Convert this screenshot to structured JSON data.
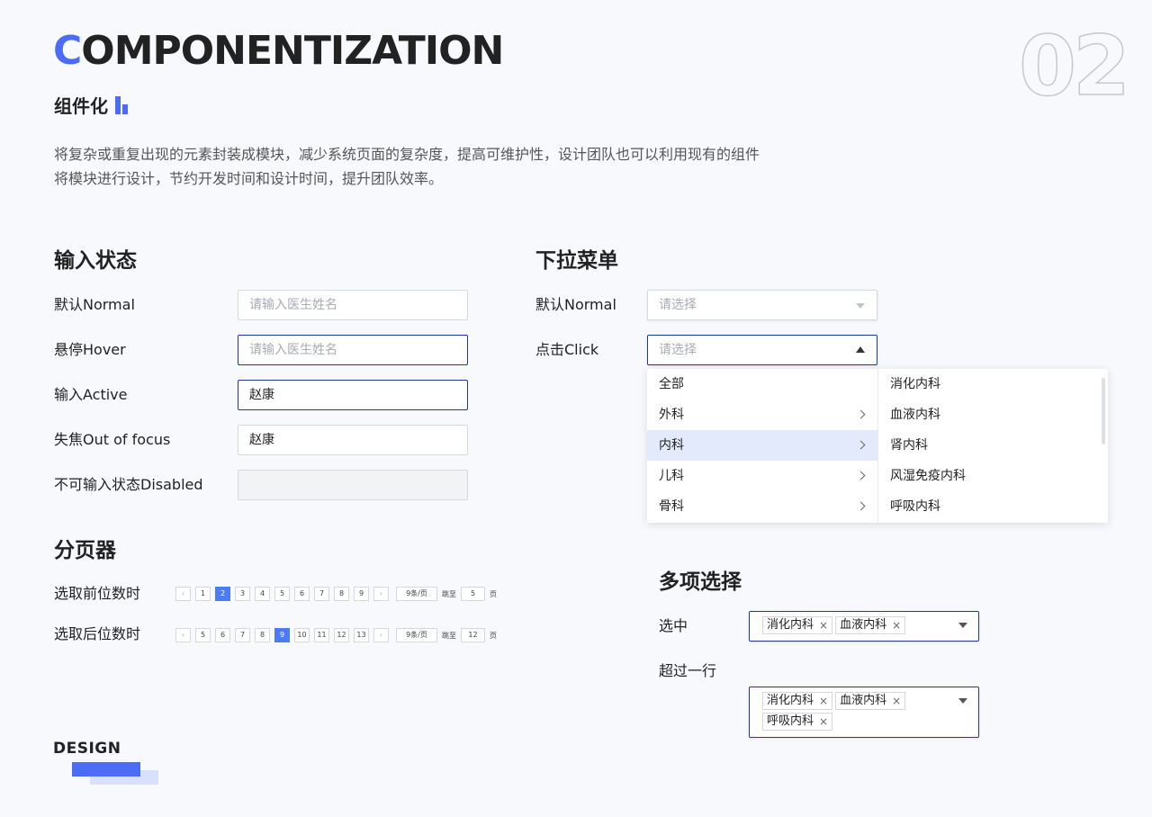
{
  "header": {
    "title_first": "C",
    "title_rest": "OMPONENTIZATION",
    "subtitle": "组件化",
    "number": "02",
    "desc_line1": "将复杂或重复出现的元素封装成模块，减少系统页面的复杂度，提高可维护性，设计团队也可以利用现有的组件",
    "desc_line2": "将模块进行设计，节约开发时间和设计时间，提升团队效率。"
  },
  "input_states": {
    "heading": "输入状态",
    "rows": [
      {
        "label": "默认Normal",
        "value": "请输入医生姓名"
      },
      {
        "label": "悬停Hover",
        "value": "请输入医生姓名"
      },
      {
        "label": "输入Active",
        "value": "赵康"
      },
      {
        "label": "失焦Out of focus",
        "value": "赵康"
      },
      {
        "label": "不可输入状态Disabled",
        "value": ""
      }
    ]
  },
  "dropdown": {
    "heading": "下拉菜单",
    "normal_label": "默认Normal",
    "normal_placeholder": "请选择",
    "click_label": "点击Click",
    "click_placeholder": "请选择",
    "level1": [
      "全部",
      "外科",
      "内科",
      "儿科",
      "骨科"
    ],
    "level2": [
      "消化内科",
      "血液内科",
      "肾内科",
      "风湿免疫内科",
      "呼吸内科"
    ]
  },
  "pagination": {
    "heading": "分页器",
    "row1": {
      "label": "选取前位数时",
      "pages": [
        "1",
        "2",
        "3",
        "4",
        "5",
        "6",
        "7",
        "8",
        "9"
      ],
      "current": "2",
      "size": "9条/页",
      "goto": "跳至",
      "goto_value": "5",
      "page_unit": "页"
    },
    "row2": {
      "label": "选取后位数时",
      "pages": [
        "5",
        "6",
        "7",
        "8",
        "9",
        "10",
        "11",
        "12",
        "13"
      ],
      "current": "9",
      "size": "9条/页",
      "goto": "跳至",
      "goto_value": "12",
      "page_unit": "页"
    },
    "prev_icon": "‹",
    "next_icon": "›"
  },
  "multi_select": {
    "heading": "多项选择",
    "selected_label": "选中",
    "selected_tags": [
      "消化内科",
      "血液内科"
    ],
    "overflow_label": "超过一行",
    "overflow_tags": [
      "消化内科",
      "血液内科",
      "呼吸内科"
    ],
    "remove_icon": "×"
  },
  "footer": {
    "design": "DESIGN"
  },
  "colors": {
    "accent": "#4a6cf7",
    "focus_border": "#1f3a93",
    "page_current": "#4a7cf6",
    "highlight_row": "#e3eafb"
  }
}
